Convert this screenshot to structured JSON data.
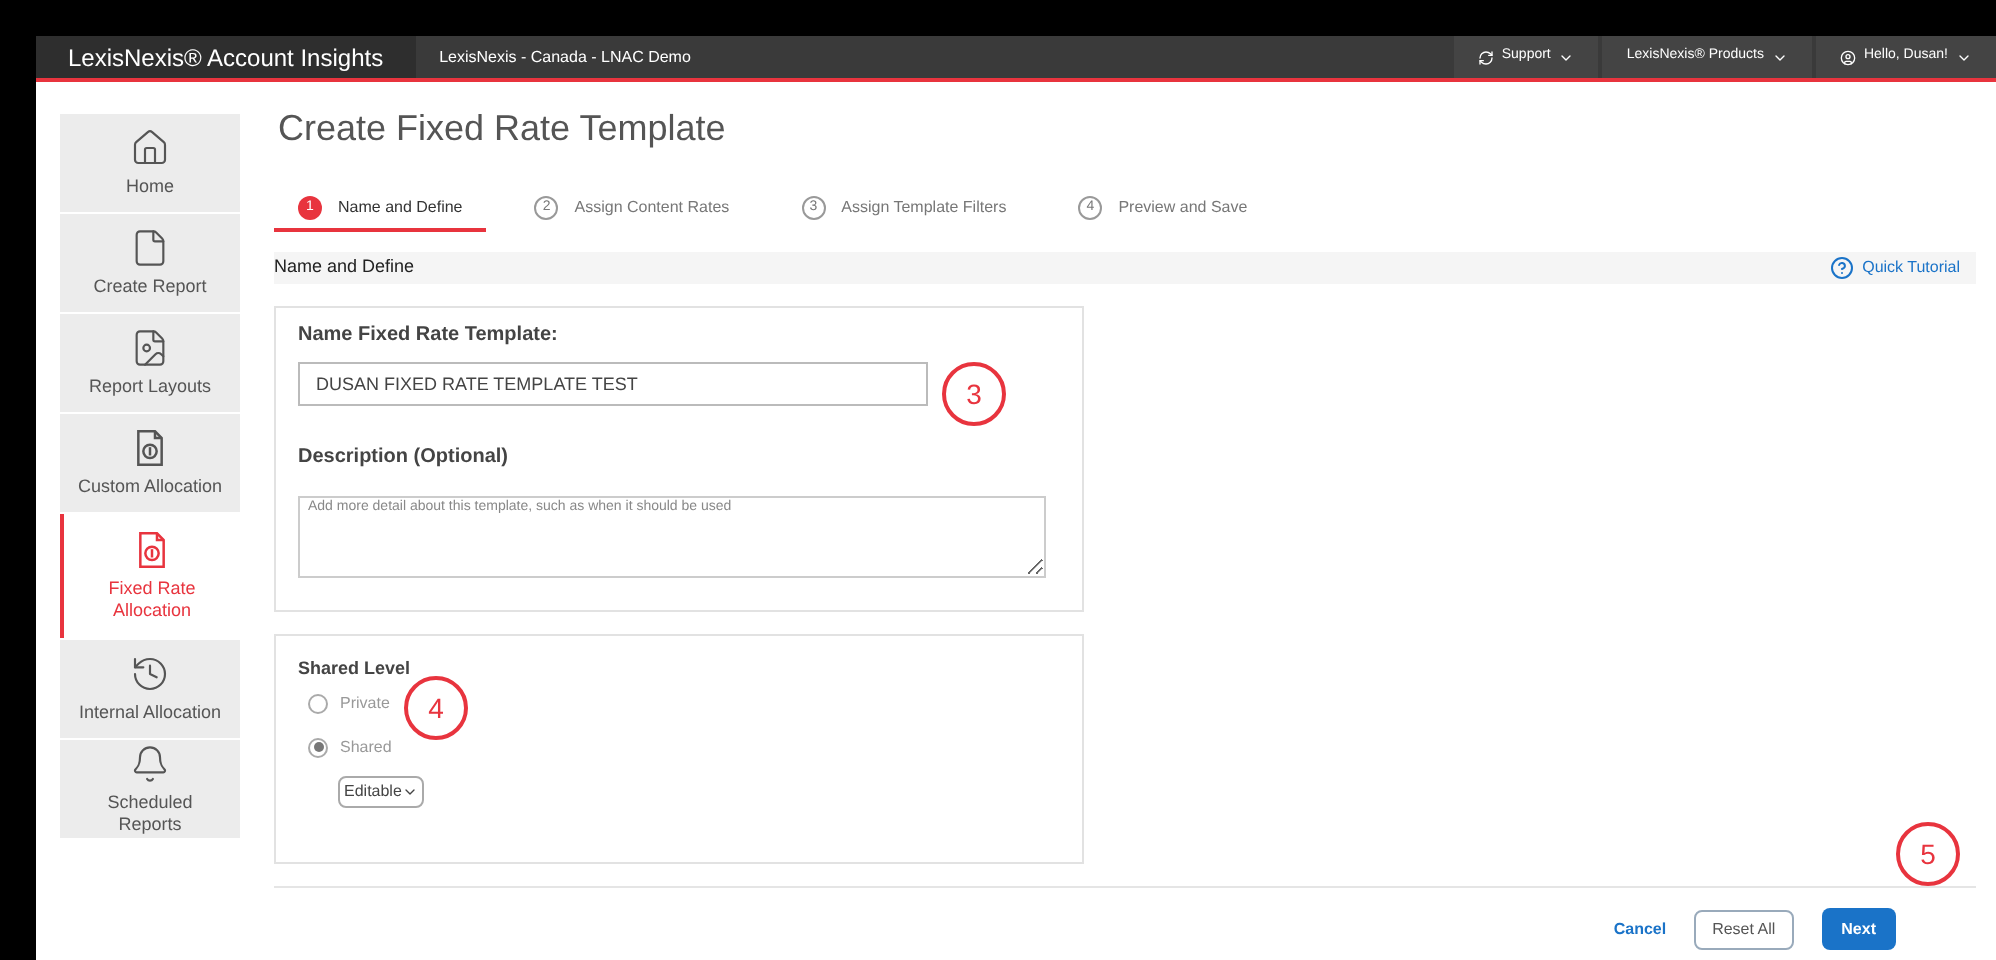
{
  "topbar": {
    "app_title": "LexisNexis® Account Insights",
    "context": "LexisNexis - Canada - LNAC Demo",
    "menus": [
      {
        "kind": "support",
        "label": "Support"
      },
      {
        "kind": "products",
        "label": "LexisNexis® Products"
      },
      {
        "kind": "user",
        "label": "Hello, Dusan!"
      }
    ]
  },
  "sidebar": {
    "items": [
      {
        "kind": "home",
        "label": "Home",
        "selected": false
      },
      {
        "kind": "document",
        "label": "Create Report",
        "selected": false
      },
      {
        "kind": "layout",
        "label": "Report Layouts",
        "selected": false
      },
      {
        "kind": "dollar",
        "label": "Custom Allocation",
        "selected": false
      },
      {
        "kind": "dollar",
        "label": "Fixed Rate Allocation",
        "selected": true
      },
      {
        "kind": "history",
        "label": "Internal Allocation",
        "selected": false
      },
      {
        "kind": "bell",
        "label": "Scheduled Reports",
        "selected": false
      }
    ]
  },
  "page_title": "Create Fixed Rate Template",
  "steps": [
    {
      "number": "1",
      "label": "Name and Define",
      "selected": true
    },
    {
      "number": "2",
      "label": "Assign Content Rates",
      "selected": false
    },
    {
      "number": "3",
      "label": "Assign Template Filters",
      "selected": false
    },
    {
      "number": "4",
      "label": "Preview and Save",
      "selected": false
    }
  ],
  "section": {
    "title": "Name and Define",
    "tutorial_link": "Quick Tutorial"
  },
  "form": {
    "name_label": "Name Fixed Rate Template:",
    "name_value": "DUSAN FIXED RATE TEMPLATE TEST",
    "description_label": "Description (Optional)",
    "description_placeholder": "Add more detail about this template, such as when it should be used"
  },
  "shared_level": {
    "label": "Shared Level",
    "options": [
      {
        "label": "Private",
        "selected": false
      },
      {
        "label": "Shared",
        "selected": true
      }
    ],
    "permission": "Editable"
  },
  "annotations": [
    "3",
    "4",
    "5"
  ],
  "buttons": {
    "cancel": "Cancel",
    "reset": "Reset All",
    "next": "Next"
  }
}
